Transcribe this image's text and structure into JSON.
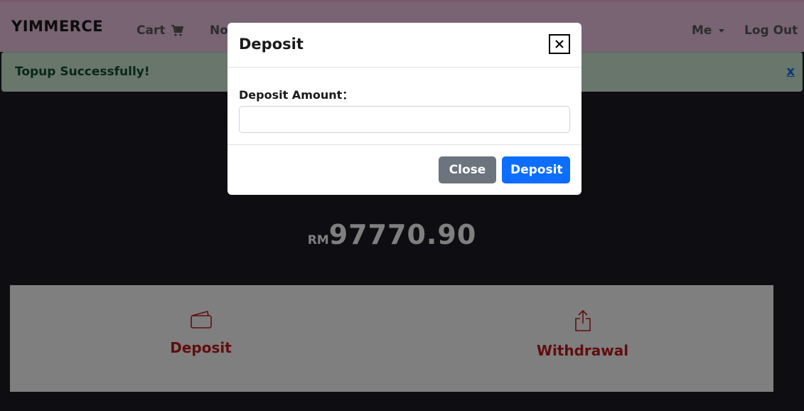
{
  "navbar": {
    "brand": "YIMMERCE",
    "cart_label": "Cart",
    "cart_icon": "cart-icon",
    "truncated_link": "No",
    "me_label": "Me",
    "logout_label": "Log Out"
  },
  "alert": {
    "message": "Topup Successfully!",
    "close_label": "x"
  },
  "wallet": {
    "currency": "RM",
    "amount": "97770.90"
  },
  "actions": {
    "deposit_label": "Deposit",
    "deposit_icon": "wallet-icon",
    "withdrawal_label": "Withdrawal",
    "withdrawal_icon": "share-upload-icon"
  },
  "modal": {
    "title": "Deposit",
    "field_label": "Deposit Amount：",
    "amount_value": "",
    "close_button": "Close",
    "deposit_button": "Deposit"
  },
  "colors": {
    "navbar_bg": "#f0c9e5",
    "alert_bg": "#d2edd9",
    "alert_text": "#0f5132",
    "action_red": "#c21a1a",
    "primary": "#0d6efd",
    "secondary": "#6c757d"
  }
}
